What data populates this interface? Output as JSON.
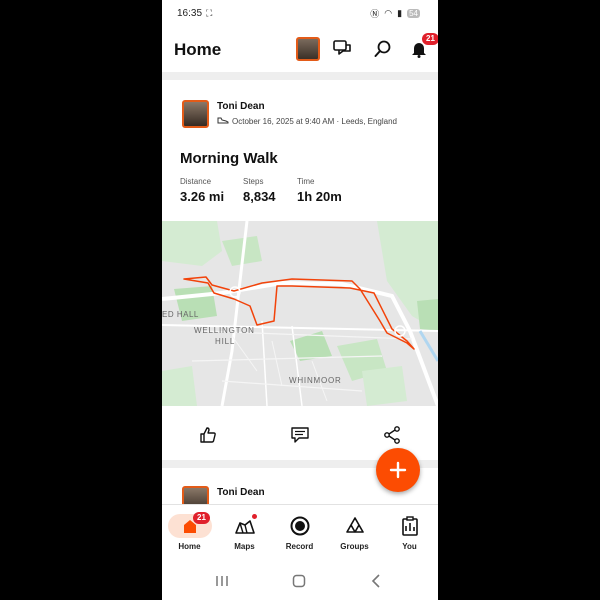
{
  "status_bar": {
    "time": "16:35",
    "battery": "54"
  },
  "header": {
    "title": "Home",
    "notifications_count": "21"
  },
  "activity": {
    "athlete_name": "Toni Dean",
    "datetime_location": "October 16, 2025 at 9:40 AM · Leeds, England",
    "title": "Morning Walk",
    "stats": [
      {
        "label": "Distance",
        "value": "3.26 mi"
      },
      {
        "label": "Steps",
        "value": "8,834"
      },
      {
        "label": "Time",
        "value": "1h 20m"
      }
    ],
    "map_labels": {
      "ed_hall": "ED HALL",
      "wellington": "WELLINGTON",
      "hill": "HILL",
      "whinmoor": "WHINMOOR"
    }
  },
  "next_activity": {
    "athlete_name": "Toni Dean"
  },
  "tabbar": {
    "home_badge": "21",
    "items": [
      {
        "label": "Home"
      },
      {
        "label": "Maps"
      },
      {
        "label": "Record"
      },
      {
        "label": "Groups"
      },
      {
        "label": "You"
      }
    ]
  },
  "colors": {
    "brand": "#fc4c02",
    "route": "#f2430a",
    "badge": "#e0202b"
  }
}
